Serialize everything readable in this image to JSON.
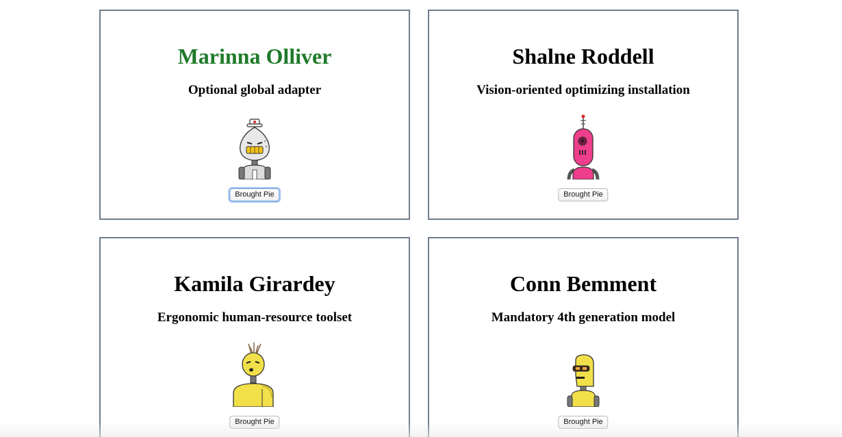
{
  "cards": [
    {
      "name": "Marinna Olliver",
      "tagline": "Optional global adapter",
      "button_label": "Brought Pie",
      "name_color": "#1f7a2a",
      "robot_color": "#e8e8e8"
    },
    {
      "name": "Shalne Roddell",
      "tagline": "Vision-oriented optimizing installation",
      "button_label": "Brought Pie",
      "name_color": "#000000",
      "robot_color": "#ee3e8c"
    },
    {
      "name": "Kamila Girardey",
      "tagline": "Ergonomic human-resource toolset",
      "button_label": "Brought Pie",
      "name_color": "#000000",
      "robot_color": "#f2e04a"
    },
    {
      "name": "Conn Bemment",
      "tagline": "Mandatory 4th generation model",
      "button_label": "Brought Pie",
      "name_color": "#000000",
      "robot_color": "#f2e04a"
    }
  ]
}
